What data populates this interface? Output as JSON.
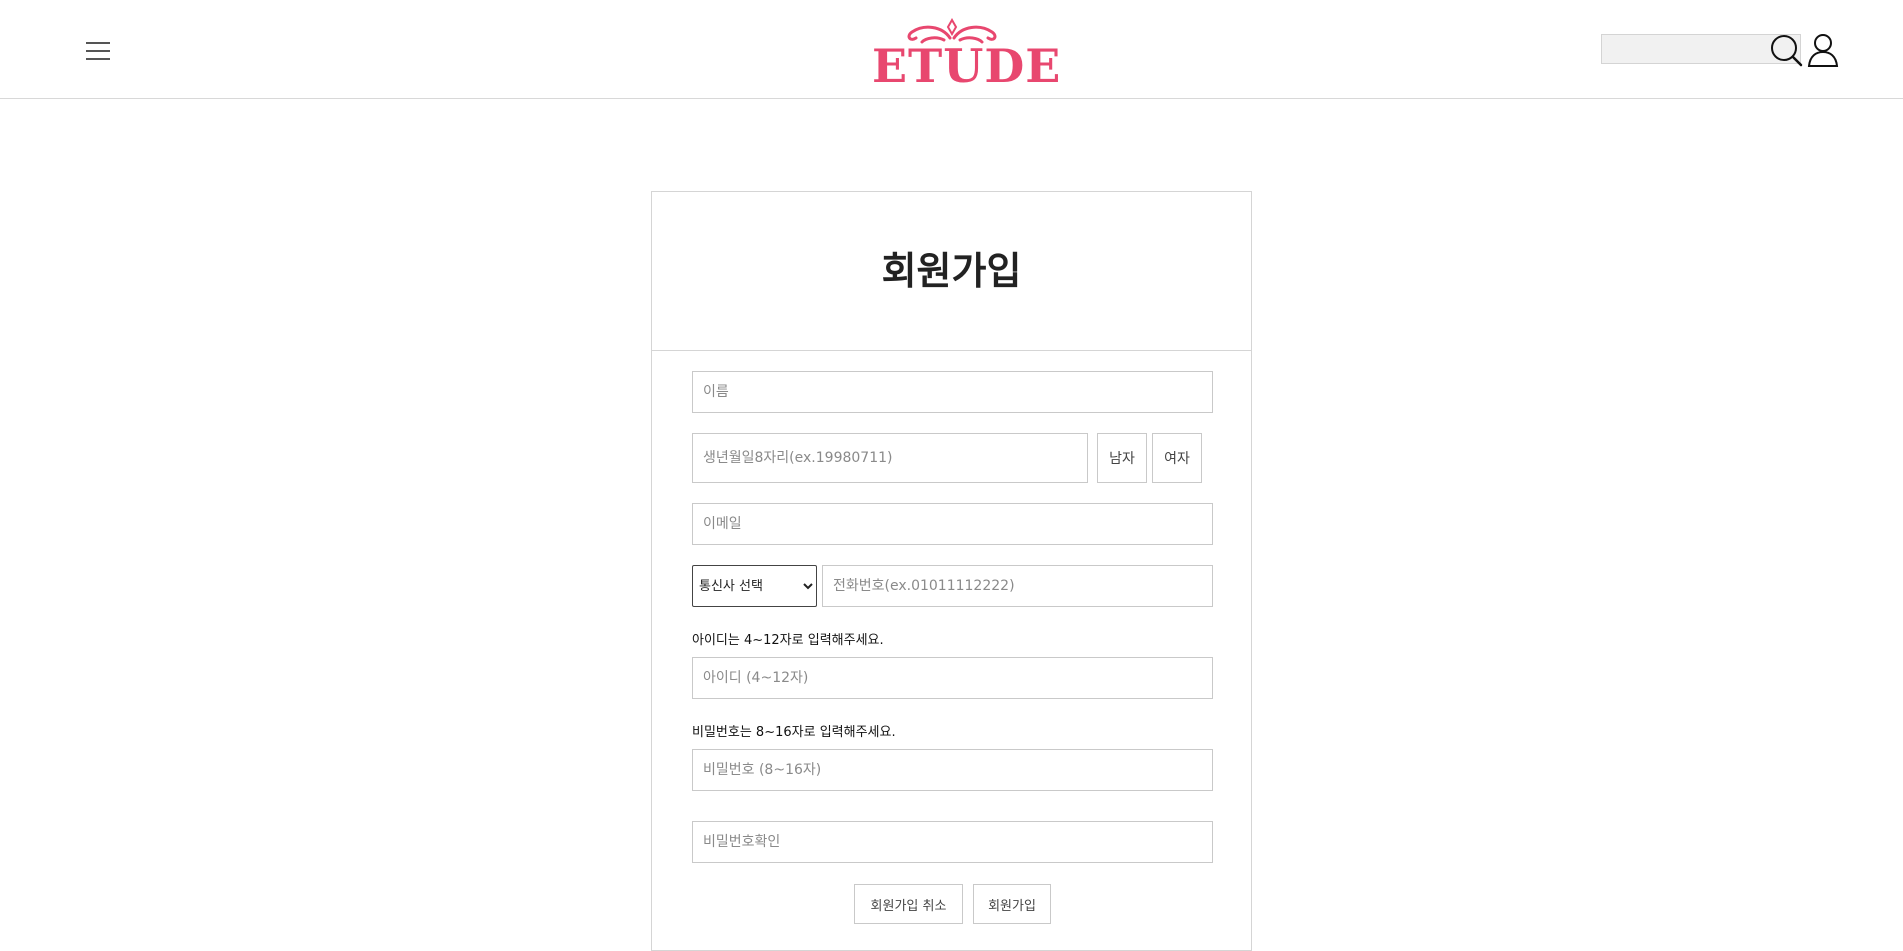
{
  "header": {
    "logo_text": "ETUDE",
    "search_placeholder": "",
    "brand_color": "#e8476f"
  },
  "signup": {
    "title": "회원가입",
    "name_placeholder": "이름",
    "birth_placeholder": "생년월일8자리(ex.19980711)",
    "male_label": "남자",
    "female_label": "여자",
    "email_placeholder": "이메일",
    "carrier_selected": "통신사 선택",
    "phone_placeholder": "전화번호(ex.01011112222)",
    "id_hint": "아이디는 4~12자로 입력해주세요.",
    "id_placeholder": "아이디 (4~12자)",
    "pw_hint": "비밀번호는 8~16자로 입력해주세요.",
    "pw_placeholder": "비밀번호 (8~16자)",
    "pw_confirm_placeholder": "비밀번호확인",
    "cancel_label": "회원가입 취소",
    "submit_label": "회원가입"
  }
}
